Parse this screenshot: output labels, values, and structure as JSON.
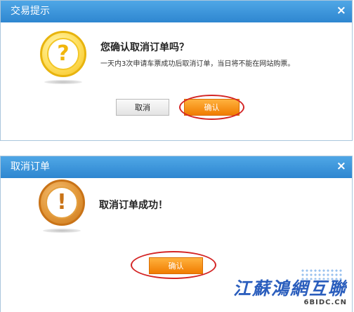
{
  "dialog1": {
    "title": "交易提示",
    "close": "×",
    "icon": "question-mark-icon",
    "heading": "您确认取消订单吗？",
    "message": "一天内3次申请车票成功后取消订单，当日将不能在网站购票。",
    "cancel_label": "取消",
    "confirm_label": "确认"
  },
  "dialog2": {
    "title": "取消订单",
    "close": "×",
    "icon": "exclamation-icon",
    "heading": "取消订单成功！",
    "confirm_label": "确认"
  },
  "watermark": {
    "text": "江蘇鴻網互聯",
    "subtext": "6BIDC.CN"
  },
  "colors": {
    "titlebar": "#3a95dc",
    "confirm_button": "#f58a0f",
    "highlight_ring": "#d42525",
    "watermark": "#2b5ebd"
  }
}
